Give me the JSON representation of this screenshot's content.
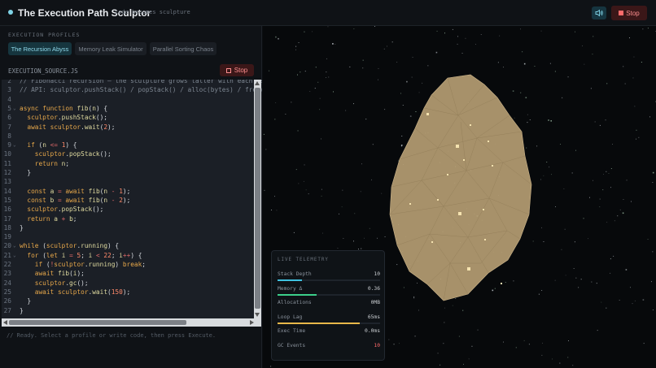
{
  "app": {
    "title": "The Execution Path Sculptor",
    "subtitle": "code becomes sculpture",
    "stop_label": "Stop"
  },
  "profiles": {
    "heading": "EXECUTION PROFILES",
    "items": [
      {
        "label": "The Recursion Abyss",
        "active": true
      },
      {
        "label": "Memory Leak Simulator",
        "active": false
      },
      {
        "label": "Parallel Sorting Chaos",
        "active": false
      }
    ]
  },
  "source": {
    "filename": "EXECUTION_SOURCE.JS",
    "stop_label": "Stop"
  },
  "code": [
    {
      "n": "2",
      "text": "// Fibonacci recursion — the sculpture grows taller with each call",
      "fold": false
    },
    {
      "n": "3",
      "text": "// API: sculptor.pushStack() / popStack() / alloc(bytes) / free()",
      "fold": false
    },
    {
      "n": "4",
      "text": "",
      "fold": false
    },
    {
      "n": "5",
      "text": "async function fib(n) {",
      "fold": true
    },
    {
      "n": "6",
      "text": "  sculptor.pushStack();",
      "fold": false
    },
    {
      "n": "7",
      "text": "  await sculptor.wait(2);",
      "fold": false
    },
    {
      "n": "8",
      "text": "",
      "fold": false
    },
    {
      "n": "9",
      "text": "  if (n <= 1) {",
      "fold": true
    },
    {
      "n": "10",
      "text": "    sculptor.popStack();",
      "fold": false
    },
    {
      "n": "11",
      "text": "    return n;",
      "fold": false
    },
    {
      "n": "12",
      "text": "  }",
      "fold": false
    },
    {
      "n": "13",
      "text": "",
      "fold": false
    },
    {
      "n": "14",
      "text": "  const a = await fib(n - 1);",
      "fold": false
    },
    {
      "n": "15",
      "text": "  const b = await fib(n - 2);",
      "fold": false
    },
    {
      "n": "16",
      "text": "  sculptor.popStack();",
      "fold": false
    },
    {
      "n": "17",
      "text": "  return a + b;",
      "fold": false
    },
    {
      "n": "18",
      "text": "}",
      "fold": false
    },
    {
      "n": "19",
      "text": "",
      "fold": false
    },
    {
      "n": "20",
      "text": "while (sculptor.running) {",
      "fold": true
    },
    {
      "n": "21",
      "text": "  for (let i = 5; i < 22; i++) {",
      "fold": true
    },
    {
      "n": "22",
      "text": "    if (!sculptor.running) break;",
      "fold": false
    },
    {
      "n": "23",
      "text": "    await fib(i);",
      "fold": false
    },
    {
      "n": "24",
      "text": "    sculptor.gc();",
      "fold": false
    },
    {
      "n": "25",
      "text": "    await sculptor.wait(150);",
      "fold": false
    },
    {
      "n": "26",
      "text": "  }",
      "fold": false
    },
    {
      "n": "27",
      "text": "}",
      "fold": false
    }
  ],
  "console": {
    "text": "// Ready. Select a profile or write code, then press Execute."
  },
  "telemetry": {
    "title": "LIVE TELEMETRY",
    "rows": [
      {
        "label": "Stack Depth",
        "value": "10",
        "bar": 0.24,
        "bar_color": "#3fc1e0",
        "value_color": "#c8ccd0"
      },
      {
        "label": "Memory Δ",
        "value": "0.36",
        "bar": 0.38,
        "bar_color": "#3ccf8a",
        "value_color": "#c8ccd0"
      },
      {
        "label": "Allocations",
        "value": "0MB",
        "bar": null,
        "bar_color": "",
        "value_color": "#c8ccd0"
      },
      {
        "label": "Loop Lag",
        "value": "65ms",
        "bar": 0.8,
        "bar_color": "#e8b84a",
        "value_color": "#c8ccd0"
      },
      {
        "label": "Exec Time",
        "value": "0.0ms",
        "bar": null,
        "bar_color": "",
        "value_color": "#c8ccd0"
      },
      {
        "label": "GC Events",
        "value": "10",
        "bar": null,
        "bar_color": "",
        "value_color": "#ff6b6b"
      }
    ]
  },
  "colors": {
    "accent": "#7fd3e6",
    "sculpture": "#b59d73",
    "danger": "#ff6b6b"
  }
}
